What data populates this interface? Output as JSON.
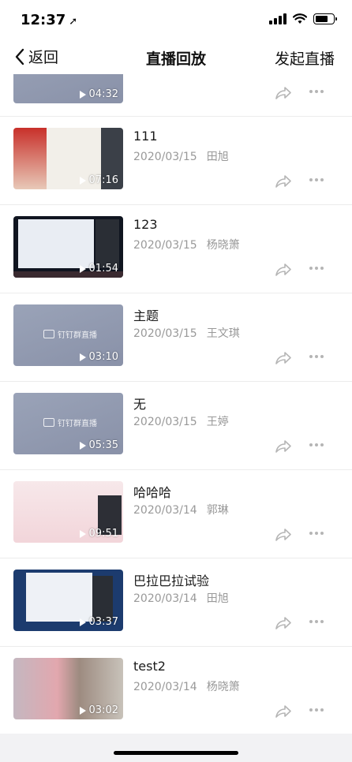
{
  "status_bar": {
    "time": "12:37",
    "location_icon": "location-arrow-icon"
  },
  "nav": {
    "back_label": "返回",
    "title": "直播回放",
    "action_label": "发起直播"
  },
  "items": [
    {
      "title": "",
      "date": "",
      "author": "",
      "duration": "04:32",
      "thumb": "grey"
    },
    {
      "title": "111",
      "date": "2020/03/15",
      "author": "田旭",
      "duration": "07:16",
      "thumb": "poster"
    },
    {
      "title": "123",
      "date": "2020/03/15",
      "author": "杨晓箫",
      "duration": "01:54",
      "thumb": "screen"
    },
    {
      "title": "主题",
      "date": "2020/03/15",
      "author": "王文琪",
      "duration": "03:10",
      "thumb": "grey"
    },
    {
      "title": "无",
      "date": "2020/03/15",
      "author": "王婷",
      "duration": "05:35",
      "thumb": "grey"
    },
    {
      "title": "哈哈哈",
      "date": "2020/03/14",
      "author": "郭琳",
      "duration": "09:51",
      "thumb": "pink"
    },
    {
      "title": "巴拉巴拉试验",
      "date": "2020/03/14",
      "author": "田旭",
      "duration": "03:37",
      "thumb": "blue"
    },
    {
      "title": "test2",
      "date": "2020/03/14",
      "author": "杨晓箫",
      "duration": "03:02",
      "thumb": "photo"
    }
  ],
  "watermark": {
    "text": "钉钉群直播"
  },
  "colors": {
    "meta_text": "#999999",
    "divider": "#ececec",
    "icon_grey": "#b5b5b5"
  }
}
